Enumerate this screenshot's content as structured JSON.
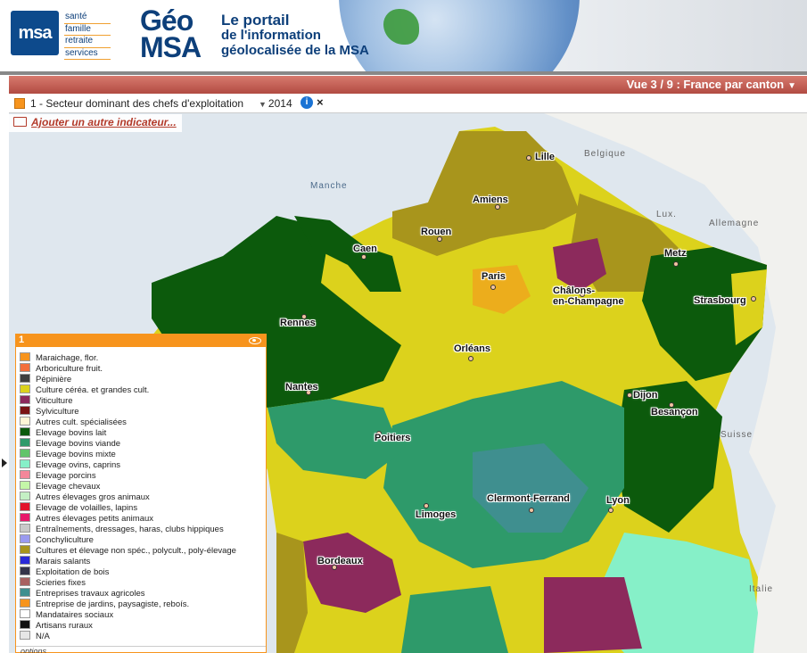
{
  "header": {
    "logo_text": "msa",
    "tags": [
      "santé",
      "famille",
      "retraite",
      "services"
    ],
    "brand_line1": "Géo",
    "brand_line2": "MSA",
    "portal_lines": [
      "Le portail",
      "de l'information",
      "géolocalisée de la MSA"
    ]
  },
  "titlebar": {
    "view": "Vue 3 / 9 : France par canton"
  },
  "indicator": {
    "label": "1 - Secteur dominant des chefs d'exploitation",
    "year": "2014",
    "info_glyph": "i",
    "close_glyph": "×"
  },
  "add_indicator": "Ajouter un autre indicateur...",
  "legend": {
    "number": "1",
    "items": [
      {
        "label": "Maraichage, flor.",
        "color": "#f7941d"
      },
      {
        "label": "Arboriculture fruit.",
        "color": "#f36f3c"
      },
      {
        "label": "Pépinière",
        "color": "#3f3f3f"
      },
      {
        "label": "Culture céréa. et grandes cult.",
        "color": "#dcd21c"
      },
      {
        "label": "Viticulture",
        "color": "#8c2a5c"
      },
      {
        "label": "Sylviculture",
        "color": "#7a1414"
      },
      {
        "label": "Autres cult. spécialisées",
        "color": "#fff6d6"
      },
      {
        "label": "Elevage bovins lait",
        "color": "#0c5a0c"
      },
      {
        "label": "Elevage bovins viande",
        "color": "#2e9a6a"
      },
      {
        "label": "Elevage bovins mixte",
        "color": "#62c46a"
      },
      {
        "label": "Elevage ovins, caprins",
        "color": "#86f0c8"
      },
      {
        "label": "Elevage porcins",
        "color": "#f4879a"
      },
      {
        "label": "Elevage chevaux",
        "color": "#c4f7a8"
      },
      {
        "label": "Autres élevages gros animaux",
        "color": "#c4f0c4"
      },
      {
        "label": "Elevage de volailles, lapins",
        "color": "#e3132b"
      },
      {
        "label": "Autres élevages petits animaux",
        "color": "#e8176a"
      },
      {
        "label": "Entraînements, dressages, haras, clubs hippiques",
        "color": "#c9c9c9"
      },
      {
        "label": "Conchyliculture",
        "color": "#9a9af0"
      },
      {
        "label": "Cultures et élevage non spéc., polycult., poly-élevage",
        "color": "#a8951c"
      },
      {
        "label": "Marais salants",
        "color": "#2a2ad8"
      },
      {
        "label": "Exploitation de bois",
        "color": "#34344a"
      },
      {
        "label": "Scieries fixes",
        "color": "#a86060"
      },
      {
        "label": "Entreprises travaux agricoles",
        "color": "#3f8f8f"
      },
      {
        "label": "Entreprise de jardins, paysagiste, reboís.",
        "color": "#f7941d"
      },
      {
        "label": "Mandataires sociaux",
        "color": "#ffffff"
      },
      {
        "label": "Artisans ruraux",
        "color": "#111111"
      },
      {
        "label": "N/A",
        "color": "#e6e6e6"
      }
    ],
    "footer": "options"
  },
  "map": {
    "seas": [
      {
        "name": "Manche"
      }
    ],
    "countries": [
      {
        "name": "Belgique"
      },
      {
        "name": "Lux."
      },
      {
        "name": "Allemagne"
      },
      {
        "name": "Suisse"
      },
      {
        "name": "Italie"
      }
    ],
    "cities": [
      {
        "name": "Lille"
      },
      {
        "name": "Amiens"
      },
      {
        "name": "Rouen"
      },
      {
        "name": "Caen"
      },
      {
        "name": "Paris"
      },
      {
        "name": "Metz"
      },
      {
        "name": "Châlons-\nen-Champagne"
      },
      {
        "name": "Strasbourg"
      },
      {
        "name": "Rennes"
      },
      {
        "name": "Orléans"
      },
      {
        "name": "Nantes"
      },
      {
        "name": "Dijon"
      },
      {
        "name": "Besançon"
      },
      {
        "name": "Poitiers"
      },
      {
        "name": "Clermont-Ferrand"
      },
      {
        "name": "Limoges"
      },
      {
        "name": "Lyon"
      },
      {
        "name": "Bordeaux"
      }
    ]
  }
}
